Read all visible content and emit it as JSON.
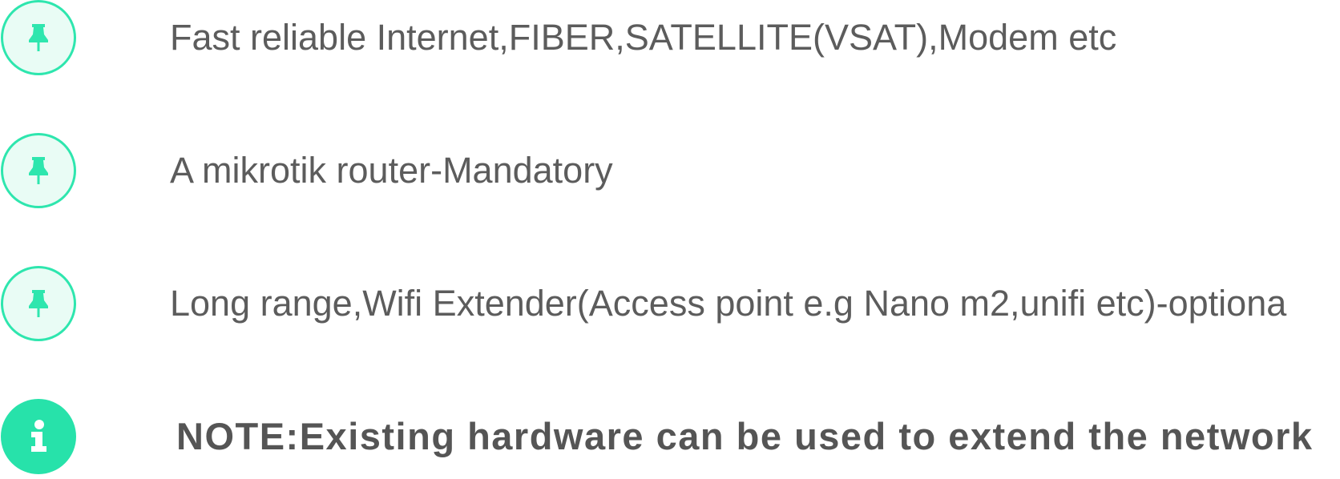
{
  "colors": {
    "accent": "#27e2aa",
    "accent_light_fill": "#e9fcf5",
    "text": "#5c5c5c"
  },
  "items": [
    {
      "icon": "pin-icon",
      "text": "Fast reliable Internet,FIBER,SATELLITE(VSAT),Modem etc"
    },
    {
      "icon": "pin-icon",
      "text": "A mikrotik router-Mandatory"
    },
    {
      "icon": "pin-icon",
      "text": "Long range,Wifi Extender(Access point e.g Nano m2,unifi etc)-optiona"
    }
  ],
  "note": {
    "icon": "info-icon",
    "text": "NOTE:Existing hardware can be used to extend the network"
  }
}
